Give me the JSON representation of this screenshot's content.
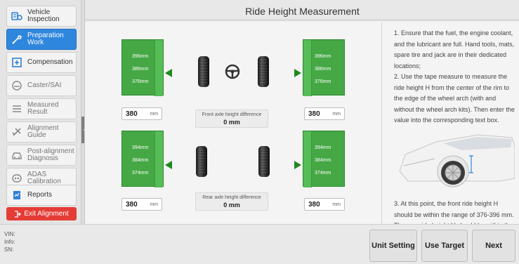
{
  "sidebar": {
    "items": [
      {
        "label": "Vehicle\nInspection",
        "icon": "vehicle-inspection-icon",
        "state": "normal"
      },
      {
        "label": "Preparation\nWork",
        "icon": "preparation-work-icon",
        "state": "active"
      },
      {
        "label": "Compensation",
        "icon": "compensation-icon",
        "state": "normal"
      },
      {
        "label": "Caster/SAI",
        "icon": "caster-sai-icon",
        "state": "disabled"
      },
      {
        "label": "Measured\nResult",
        "icon": "measured-result-icon",
        "state": "disabled"
      },
      {
        "label": "Alignment\nGuide",
        "icon": "alignment-guide-icon",
        "state": "disabled"
      },
      {
        "label": "Post-alignment\nDiagnosis",
        "icon": "post-alignment-diagnosis-icon",
        "state": "disabled"
      },
      {
        "label": "ADAS\nCalibration",
        "icon": "adas-calibration-icon",
        "state": "disabled"
      },
      {
        "label": "Reports",
        "icon": "reports-icon",
        "state": "normal"
      }
    ],
    "exit_label": "Exit Alignment"
  },
  "page_title": "Ride Height Measurement",
  "front": {
    "left": {
      "ticks": [
        "396mm",
        "386mm",
        "376mm"
      ],
      "value": "380",
      "unit": "mm"
    },
    "right": {
      "ticks": [
        "396mm",
        "386mm",
        "376mm"
      ],
      "value": "380",
      "unit": "mm"
    },
    "diff_label": "Front axle height difference",
    "diff_value": "0 mm"
  },
  "rear": {
    "left": {
      "ticks": [
        "394mm",
        "384mm",
        "374mm"
      ],
      "value": "380",
      "unit": "mm"
    },
    "right": {
      "ticks": [
        "394mm",
        "384mm",
        "374mm"
      ],
      "value": "380",
      "unit": "mm"
    },
    "diff_label": "Rear axle height difference",
    "diff_value": "0 mm"
  },
  "instructions": {
    "main": "1. Ensure that the fuel, the engine coolant, and the lubricant are full. Hand tools, mats, spare tire and jack are in their dedicated locations;\n2. Use the tape measure to measure the ride height H from the center of the rim to the edge of the wheel arch (with and without the wheel arch kits). Then enter the value into the corresponding text box.",
    "step3": "3. At this point, the front ride height H should be within the range of 376-396 mm. The rear ride height H should be within the"
  },
  "footer": {
    "vin_label": "VIN:",
    "info_label": "Info:",
    "sn_label": "SN:",
    "buttons": {
      "unit_setting": "Unit Setting",
      "use_target": "Use Target",
      "next": "Next"
    }
  },
  "colors": {
    "accent": "#2f86dd",
    "gauge_green": "#45a845",
    "exit_red": "#e53c36"
  }
}
